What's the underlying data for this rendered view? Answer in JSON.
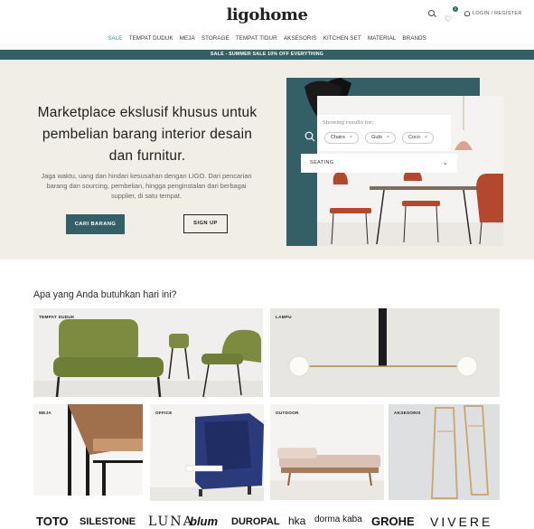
{
  "header": {
    "logo": "ligohome",
    "wishlist_count": "0",
    "login_label": "LOGIN / REGISTER"
  },
  "nav": {
    "items": [
      "SALE",
      "TEMPAT DUDUK",
      "MEJA",
      "STORAGE",
      "TEMPAT TIDUR",
      "AKSESORIS",
      "KITCHEN SET",
      "MATERIAL",
      "BRANDS"
    ]
  },
  "promo_bar": "SALE - SUMMER SALE 10% OFF EVERYTHING",
  "hero": {
    "title": "Marketplace ekslusif khusus untuk pembelian barang interior desain dan furnitur.",
    "description": "Jaga waktu, uang dan hindari kesusahan dengan LIGO. Dari pencarian barang dan sourcing, pembelian, hingga penginstalan dari berbagai supplier, di satu tempat.",
    "primary_button": "CARI BARANG",
    "secondary_button": "SIGN UP",
    "search_widget": {
      "results_label": "Showing results for:",
      "chips": [
        "Chairs",
        "Gubi",
        "Coco"
      ],
      "select_value": "SEATING"
    }
  },
  "categories": {
    "heading": "Apa yang Anda butuhkan hari ini?",
    "tiles": [
      "TEMPAT DUDUK",
      "LAMPU",
      "MEJA",
      "OFFICE",
      "OUTDOOR",
      "AKSESORIS"
    ]
  },
  "brands": [
    "TOTO",
    "SILESTONE",
    "LUNA",
    "blum",
    "DUROPAL",
    "hka",
    "dorma kaba",
    "GROHE",
    "VIVERE"
  ],
  "colors": {
    "accent_teal": "#345f66",
    "nav_sale": "#3a8fa0",
    "hero_bg": "#f1eee8"
  },
  "icons": [
    "search-icon",
    "heart-icon",
    "user-icon",
    "close-icon",
    "chevron-down-icon"
  ]
}
